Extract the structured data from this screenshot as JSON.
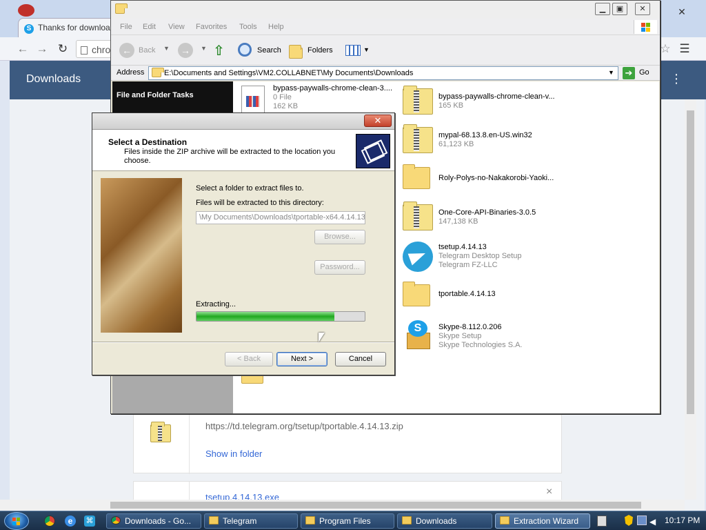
{
  "chrome": {
    "tab_title": "Thanks for downloa",
    "address_partial": "chro",
    "page_title": "Downloads",
    "download_url": "https://td.telegram.org/tsetup/tportable.4.14.13.zip",
    "show_in_folder": "Show in folder",
    "next_item_title": "tsetup.4.14.13.exe",
    "remove_glyph": "×",
    "close_glyph": "✕",
    "menu_glyph": "⋮"
  },
  "explorer": {
    "menus": [
      "File",
      "Edit",
      "View",
      "Favorites",
      "Tools",
      "Help"
    ],
    "toolbar": {
      "back": "Back",
      "search": "Search",
      "folders": "Folders"
    },
    "address_label": "Address",
    "address_value": "E:\\Documents and Settings\\VM2.COLLABNET\\My Documents\\Downloads",
    "go_label": "Go",
    "sidepane_title": "File and Folder Tasks",
    "files_left": [
      {
        "name": "bypass-paywalls-chrome-clean-3....",
        "line2": "0 File",
        "line3": "162 KB"
      }
    ],
    "files_right": [
      {
        "name": "bypass-paywalls-chrome-clean-v...",
        "line2": "165 KB",
        "line3": "",
        "icon": "zip-folder-icon"
      },
      {
        "name": "mypal-68.13.8.en-US.win32",
        "line2": "61,123 KB",
        "line3": "",
        "icon": "zip-folder-icon"
      },
      {
        "name": "Roly-Polys-no-Nakakorobi-Yaoki...",
        "line2": "",
        "line3": "",
        "icon": "folder-icon"
      },
      {
        "name": "One-Core-API-Binaries-3.0.5",
        "line2": "147,138 KB",
        "line3": "",
        "icon": "zip-folder-icon"
      },
      {
        "name": "tsetup.4.14.13",
        "line2": "Telegram Desktop Setup",
        "line3": "Telegram FZ-LLC",
        "icon": "telegram-icon"
      },
      {
        "name": "tportable.4.14.13",
        "line2": "",
        "line3": "",
        "icon": "folder-icon"
      },
      {
        "name": "Skype-8.112.0.206",
        "line2": "Skype Setup",
        "line3": "Skype Technologies S.A.",
        "icon": "skype-setup-icon"
      }
    ]
  },
  "dialog": {
    "heading": "Select a Destination",
    "subheading": "Files inside the ZIP archive will be extracted to the location you choose.",
    "select_folder_label": "Select a folder to extract files to.",
    "directory_label": "Files will be extracted to this directory:",
    "directory_value": "\\My Documents\\Downloads\\tportable-x64.4.14.13",
    "browse_button": "Browse...",
    "password_button": "Password...",
    "extracting_label": "Extracting...",
    "progress_fraction": 0.82,
    "back_button": "< Back",
    "next_button": "Next >",
    "cancel_button": "Cancel"
  },
  "taskbar": {
    "buttons": [
      {
        "label": "Downloads - Go...",
        "active": false
      },
      {
        "label": "Telegram",
        "active": false
      },
      {
        "label": "Program Files",
        "active": false
      },
      {
        "label": "Downloads",
        "active": false
      },
      {
        "label": "Extraction Wizard",
        "active": true
      }
    ],
    "clock": "10:17 PM"
  }
}
